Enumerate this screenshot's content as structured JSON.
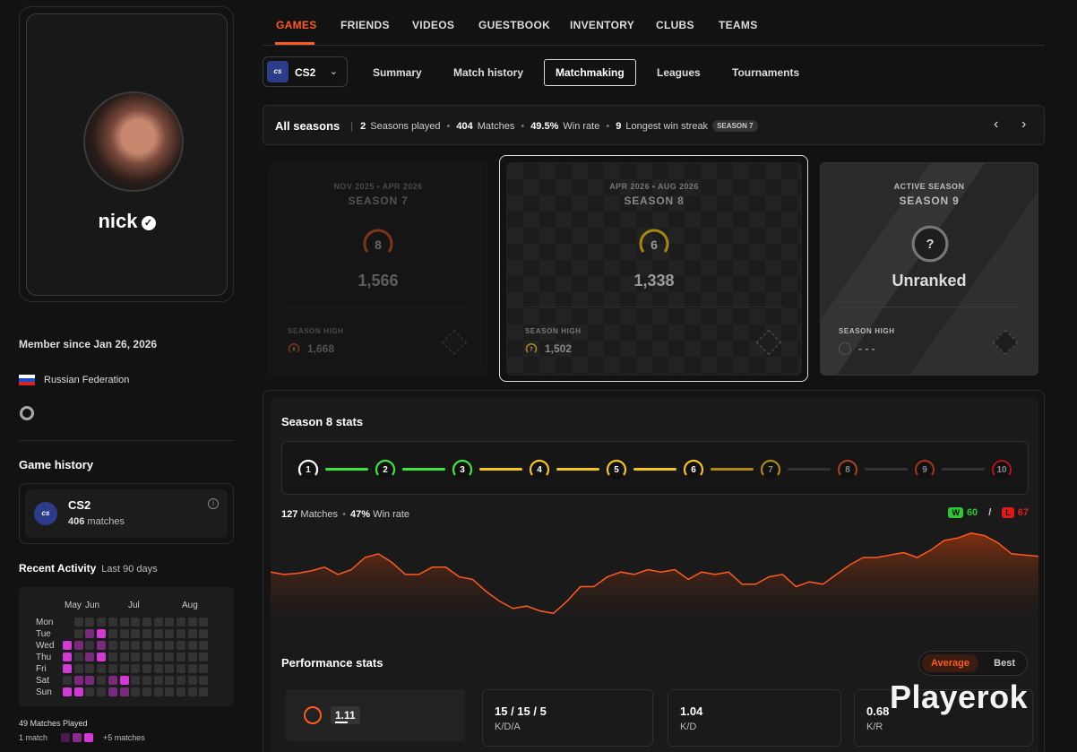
{
  "profile": {
    "username": "nick",
    "member_since": "Member since Jan 26, 2026",
    "country": "Russian Federation"
  },
  "game_history": {
    "title": "Game history",
    "game": "CS2",
    "game_logo_text": "cs",
    "matches_count": "406",
    "matches_suffix": "matches"
  },
  "recent_activity": {
    "title": "Recent Activity",
    "period": "Last 90 days",
    "months": [
      "May",
      "Jun",
      "Jul",
      "Aug"
    ],
    "days": [
      "Mon",
      "Tue",
      "Wed",
      "Thu",
      "Fri",
      "Sat",
      "Sun"
    ],
    "matches_played": "49 Matches Played",
    "legend_low": "1 match",
    "legend_high": "+5 matches",
    "color_active": "#d23ad6"
  },
  "nav": {
    "tabs": [
      "GAMES",
      "FRIENDS",
      "VIDEOS",
      "GUESTBOOK",
      "INVENTORY",
      "CLUBS",
      "TEAMS"
    ],
    "active": "GAMES",
    "accent": "#ff5a1f"
  },
  "game_select": {
    "label": "CS2",
    "logo_text": "cs"
  },
  "subtabs": [
    "Summary",
    "Match history",
    "Matchmaking",
    "Leagues",
    "Tournaments"
  ],
  "seasons_summary": {
    "title": "All seasons",
    "seasons_played": "2",
    "seasons_label": "Seasons played",
    "matches": "404",
    "matches_label": "Matches",
    "win_rate": "49.5%",
    "win_rate_label": "Win rate",
    "streak": "9",
    "streak_label": "Longest win streak",
    "streak_badge": "SEASON 7"
  },
  "seasons": [
    {
      "dates": "NOV 2025 • APR 2026",
      "name": "SEASON 7",
      "rank": "8",
      "rating": "1,566",
      "high_label": "SEASON HIGH",
      "high_rank": "8",
      "high_value": "1,668",
      "rank_color": "#d9501e"
    },
    {
      "dates": "APR 2026 • AUG 2026",
      "name": "SEASON 8",
      "rank": "6",
      "rating": "1,338",
      "high_label": "SEASON HIGH",
      "high_rank": "7",
      "high_value": "1,502",
      "rank_color": "#e8b40c"
    },
    {
      "dates": "ACTIVE SEASON",
      "name": "SEASON 9",
      "rank": "?",
      "rating": "Unranked",
      "high_label": "SEASON HIGH",
      "high_rank": "",
      "high_value": "- - -",
      "rank_color": "#888888"
    }
  ],
  "season_stats": {
    "title": "Season 8 stats",
    "levels": [
      "1",
      "2",
      "3",
      "4",
      "5",
      "6",
      "7",
      "8",
      "9",
      "10"
    ],
    "level_colors": [
      "#ffffff",
      "#3ee63e",
      "#3ee63e",
      "#f5c518",
      "#f5c518",
      "#f5c518",
      "#b08a10",
      "#a04020",
      "#a03020",
      "#a01818"
    ],
    "matches": "127",
    "matches_label": "Matches",
    "win_rate": "47%",
    "win_rate_label": "Win rate",
    "wins_badge": "W",
    "wins": "60",
    "losses_badge": "L",
    "losses": "67"
  },
  "chart_data": {
    "type": "area",
    "values": [
      1500,
      1490,
      1495,
      1505,
      1520,
      1490,
      1510,
      1560,
      1575,
      1540,
      1490,
      1490,
      1520,
      1520,
      1480,
      1470,
      1420,
      1380,
      1350,
      1360,
      1340,
      1330,
      1380,
      1440,
      1440,
      1480,
      1500,
      1490,
      1510,
      1500,
      1510,
      1470,
      1500,
      1490,
      1500,
      1450,
      1450,
      1480,
      1490,
      1440,
      1460,
      1450,
      1490,
      1530,
      1560,
      1560,
      1570,
      1580,
      1560,
      1590,
      1630,
      1640,
      1660,
      1650,
      1620,
      1575,
      1570,
      1565
    ],
    "color": "#ff5a1f"
  },
  "performance": {
    "title": "Performance stats",
    "toggle": [
      "Average",
      "Best"
    ],
    "rating": "1.11",
    "kda": "15 / 15 / 5",
    "kda_label": "K/D/A",
    "kd": "1.04",
    "kd_label": "K/D",
    "kr": "0.68",
    "kr_label": "K/R"
  },
  "watermark": "Playerok"
}
